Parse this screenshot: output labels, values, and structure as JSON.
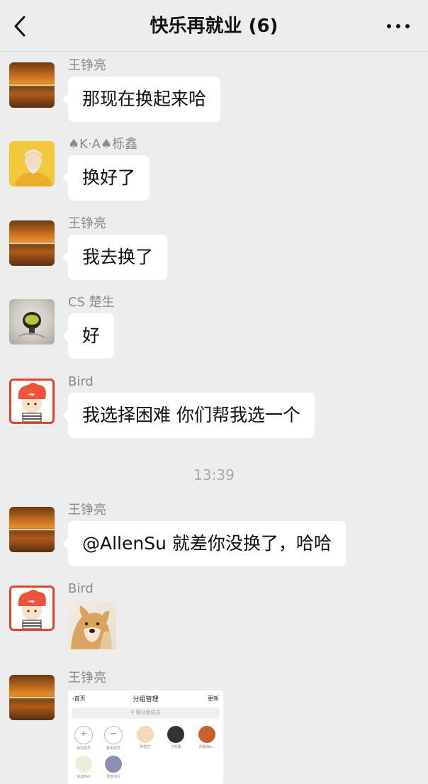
{
  "header": {
    "title": "快乐再就业 (6)"
  },
  "messages": [
    {
      "sender": "王铮亮",
      "text": "那现在换起来哈"
    },
    {
      "sender": "♠K·A♠栎鑫",
      "text": "换好了"
    },
    {
      "sender": "王铮亮",
      "text": "我去换了"
    },
    {
      "sender": "CS 楚生",
      "text": "好"
    },
    {
      "sender": "Bird",
      "text": "我选择困难 你们帮我选一个"
    },
    {
      "sender": "王铮亮",
      "text": "@AllenSu 就差你没换了，哈哈"
    },
    {
      "sender": "Bird",
      "sticker": "doge-sticker"
    },
    {
      "sender": "王铮亮",
      "image": "screenshot"
    }
  ],
  "timestamp": "13:39",
  "screenshot": {
    "back_label": "首页",
    "title": "分组管理",
    "update_label": "更新",
    "search_placeholder": "搜分组成员",
    "members": [
      {
        "label": "添加成员"
      },
      {
        "label": "移出成员"
      },
      {
        "label": "陈楚生"
      },
      {
        "label": "王栎鑫"
      },
      {
        "label": "苏醒Alle..."
      },
      {
        "label": "就这Bird"
      },
      {
        "label": "陆虎/NG"
      }
    ]
  },
  "colors": {
    "background": "#ededed",
    "bubble": "#ffffff",
    "bird_frame": "#e8402f"
  }
}
